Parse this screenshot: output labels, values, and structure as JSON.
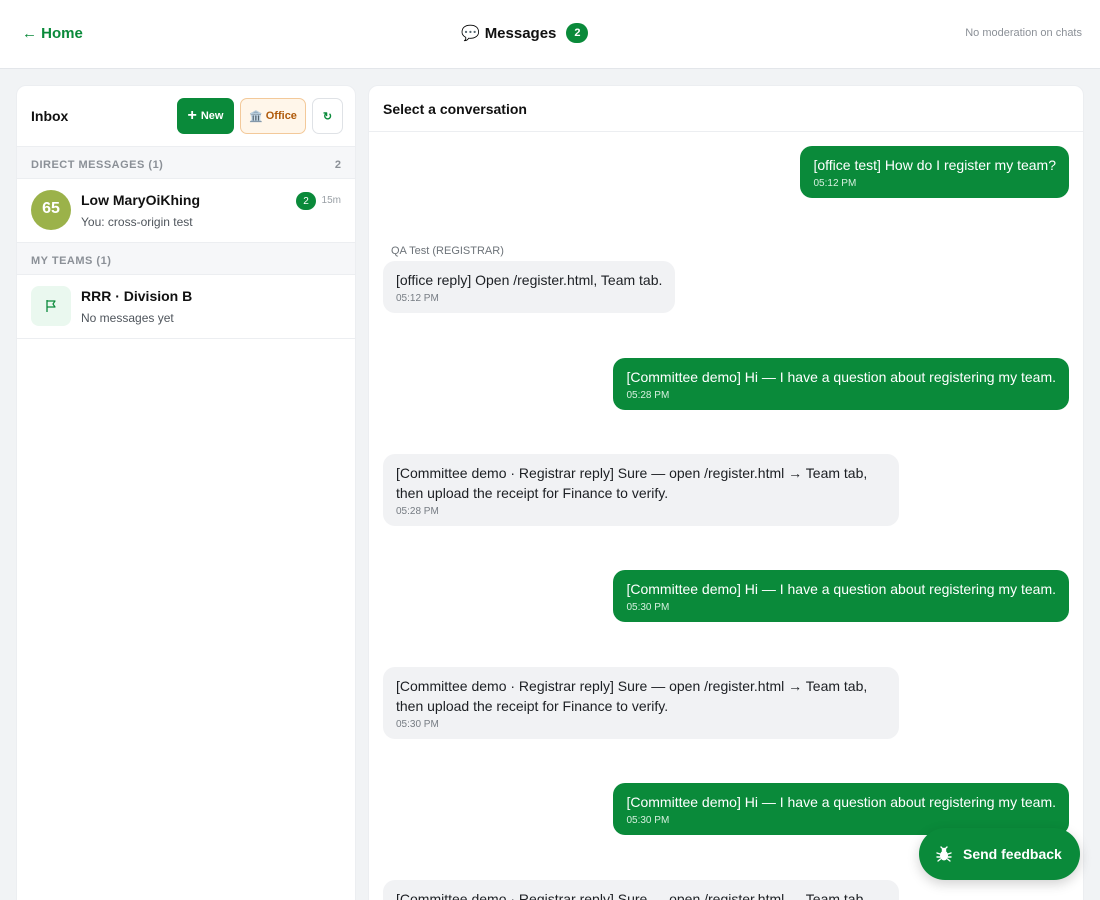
{
  "topbar": {
    "home_label": "← Home",
    "title_icon": "💬",
    "title": "Messages",
    "unread_total": "2",
    "moderation_note": "No moderation on chats"
  },
  "inbox": {
    "title": "Inbox",
    "new_label": "New",
    "office_icon": "🏛️",
    "office_label": "Office",
    "refresh_label": "↻",
    "direct": {
      "label": "DIRECT MESSAGES (1)",
      "count": "2",
      "items": [
        {
          "avatar_text": "65",
          "name": "Low MaryOiKhing",
          "preview": "You: cross-origin test",
          "unread": "2",
          "time": "15m"
        }
      ]
    },
    "teams": {
      "label": "MY TEAMS (1)",
      "items": [
        {
          "icon": "flag-icon",
          "name": "RRR · Division B",
          "preview": "No messages yet"
        }
      ]
    }
  },
  "conversation": {
    "title": "Select a conversation",
    "messages": [
      {
        "dir": "out",
        "text": "[office test] How do I register my team?",
        "time": "05:12 PM"
      },
      {
        "dir": "in",
        "sender": "QA Test (REGISTRAR)",
        "text": "[office reply] Open /register.html, Team tab.",
        "time": "05:12 PM"
      },
      {
        "dir": "out",
        "text": "[Committee demo] Hi — I have a question about registering my team.",
        "time": "05:28 PM"
      },
      {
        "dir": "in",
        "text": "[Committee demo · Registrar reply] Sure — open /register.html → Team tab, then upload the receipt for Finance to verify.",
        "time": "05:28 PM"
      },
      {
        "dir": "out",
        "text": "[Committee demo] Hi — I have a question about registering my team.",
        "time": "05:30 PM"
      },
      {
        "dir": "in",
        "text": "[Committee demo · Registrar reply] Sure — open /register.html → Team tab, then upload the receipt for Finance to verify.",
        "time": "05:30 PM"
      },
      {
        "dir": "out",
        "text": "[Committee demo] Hi — I have a question about registering my team.",
        "time": "05:30 PM"
      },
      {
        "dir": "in",
        "text": "[Committee demo · Registrar reply] Sure — open /register.html → Team tab,",
        "time": ""
      }
    ]
  },
  "feedback": {
    "label": "Send feedback",
    "icon": "bug-icon"
  },
  "colors": {
    "brand_green": "#0a8a3a",
    "office_orange": "#b05a0a",
    "avatar_olive": "#9bb24a"
  }
}
